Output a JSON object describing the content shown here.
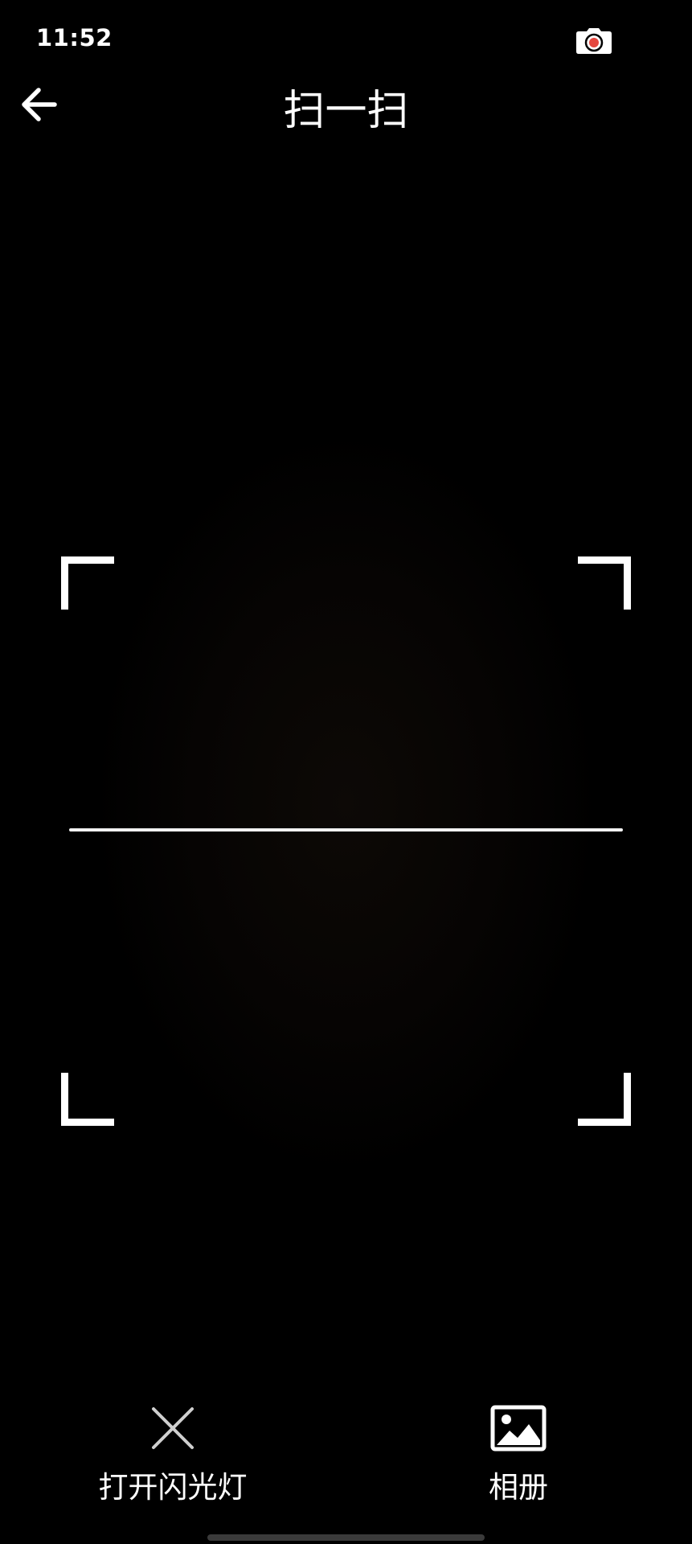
{
  "status_bar": {
    "time": "11:52",
    "indicator_icon": "camera-recording-icon",
    "indicator_dot_color": "#e5473f"
  },
  "header": {
    "back_icon": "arrow-left-icon",
    "title": "扫一扫"
  },
  "scanner": {
    "frame_color": "#ffffff",
    "scan_line_color": "#f2f2f2"
  },
  "controls": {
    "flash": {
      "icon": "close-icon",
      "label": "打开闪光灯"
    },
    "album": {
      "icon": "image-icon",
      "label": "相册"
    }
  }
}
